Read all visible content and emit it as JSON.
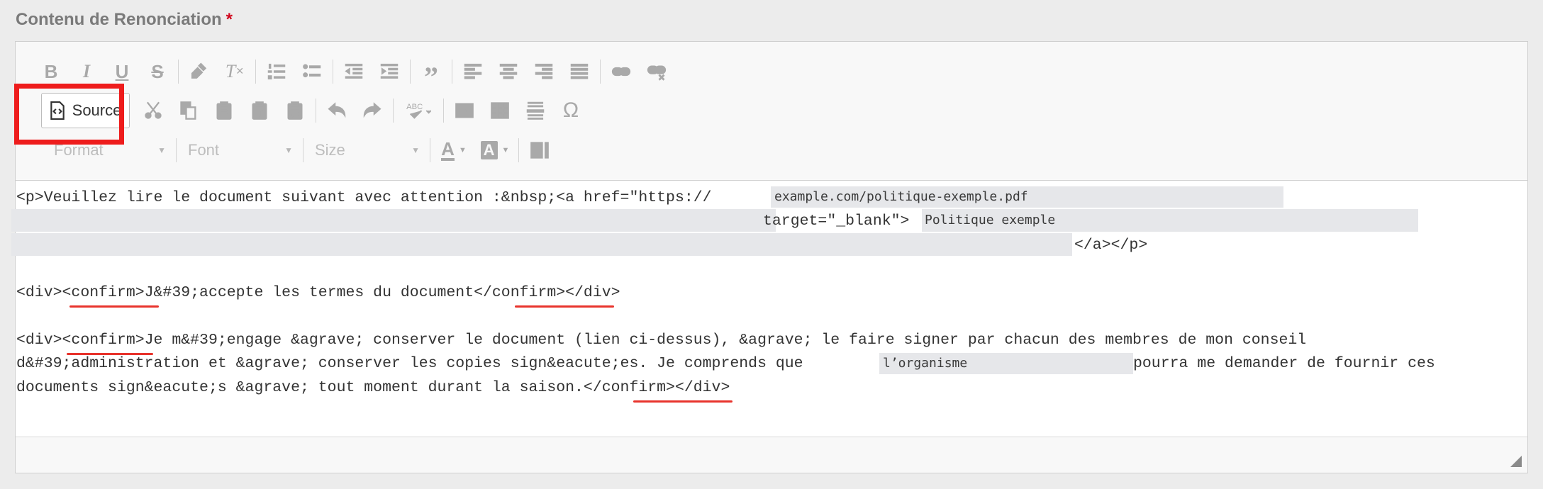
{
  "field": {
    "label": "Contenu de Renonciation",
    "required_mark": "*"
  },
  "toolbar": {
    "row1": [
      "bold-icon",
      "italic-icon",
      "underline-icon",
      "strikethrough-icon",
      "copy-format-icon",
      "remove-format-icon",
      "numbered-list-icon",
      "bulleted-list-icon",
      "decrease-indent-icon",
      "increase-indent-icon",
      "blockquote-icon",
      "align-left-icon",
      "align-center-icon",
      "align-right-icon",
      "justify-icon",
      "link-icon",
      "unlink-icon"
    ],
    "source_label": "Source",
    "format_label": "Format",
    "font_label": "Font",
    "size_label": "Size"
  },
  "content": {
    "line1_prefix": "<p>Veuillez lire le document suivant avec attention :&nbsp;<a href=\"https://",
    "line1_hl": "example.com/politique-exemple.pdf",
    "line2_prefix": "target=\"_blank\">",
    "line2_hl": "Politique exemple",
    "line3_suffix": "</a></p>",
    "line4": "<div><confirm>J&#39;accepte les termes du document</confirm></div>",
    "line5": "<div><confirm>Je m&#39;engage &agrave; conserver le document (lien ci-dessus), &agrave; le faire signer par chacun des membres de mon conseil",
    "line6_prefix": "d&#39;administration et &agrave; conserver les copies sign&eacute;es. Je comprends que ",
    "line6_hl": "l’organisme",
    "line6_suffix": "pourra me demander de fournir ces",
    "line7": "documents sign&eacute;s &agrave; tout moment durant la saison.</confirm></div>"
  },
  "colors": {
    "highlight": "#ee1c1c",
    "underline": "#e8332c"
  }
}
